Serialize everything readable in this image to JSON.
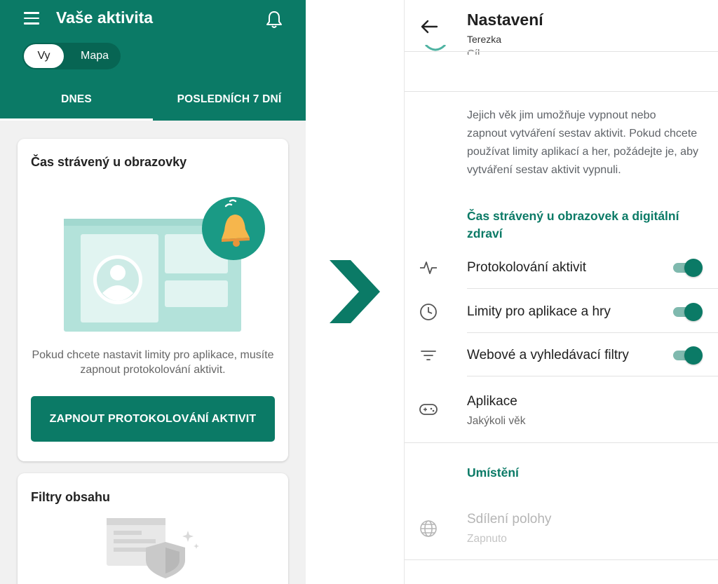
{
  "left_screen": {
    "header": {
      "title": "Vaše aktivita",
      "segments": [
        "Vy",
        "Mapa"
      ],
      "selected_segment": "Vy",
      "tabs": [
        "DNES",
        "POSLEDNÍCH 7 DNÍ"
      ],
      "selected_tab": "DNES",
      "menu_icon": "menu-icon",
      "bell_icon": "bell-icon"
    },
    "screen_time_card": {
      "title": "Čas strávený u obrazovky",
      "description": "Pokud chcete nastavit limity pro aplikace, musíte zapnout protokolování aktivit.",
      "button_label": "ZAPNOUT PROTOKOLOVÁNÍ AKTIVIT"
    },
    "content_filters_card": {
      "title": "Filtry obsahu"
    }
  },
  "right_screen": {
    "header": {
      "title": "Nastavení",
      "subtitle": "Terezka"
    },
    "cut_item_label": "Cíl",
    "info_text": "Jejich věk jim umožňuje vypnout nebo zapnout vytváření sestav aktivit. Pokud chcete používat limity aplikací a her, požádejte je, aby vytváření sestav aktivit vypnuli.",
    "section_screen_time": "Čas strávený u obrazovek a digitální zdraví",
    "settings": [
      {
        "label": "Protokolování aktivit",
        "icon": "activity-icon",
        "enabled": true
      },
      {
        "label": "Limity pro aplikace a hry",
        "icon": "clock-icon",
        "enabled": true
      },
      {
        "label": "Webové a vyhledávací filtry",
        "icon": "filter-icon",
        "enabled": true
      }
    ],
    "apps": {
      "label": "Aplikace",
      "sub": "Jakýkoli věk",
      "icon": "gamepad-icon"
    },
    "section_location": "Umístění",
    "location": {
      "label": "Sdílení polohy",
      "sub": "Zapnuto",
      "icon": "globe-icon"
    }
  },
  "colors": {
    "primary": "#0b7a66",
    "switch_track": "#7fb9ae",
    "page_bg": "#f1f1f1"
  }
}
